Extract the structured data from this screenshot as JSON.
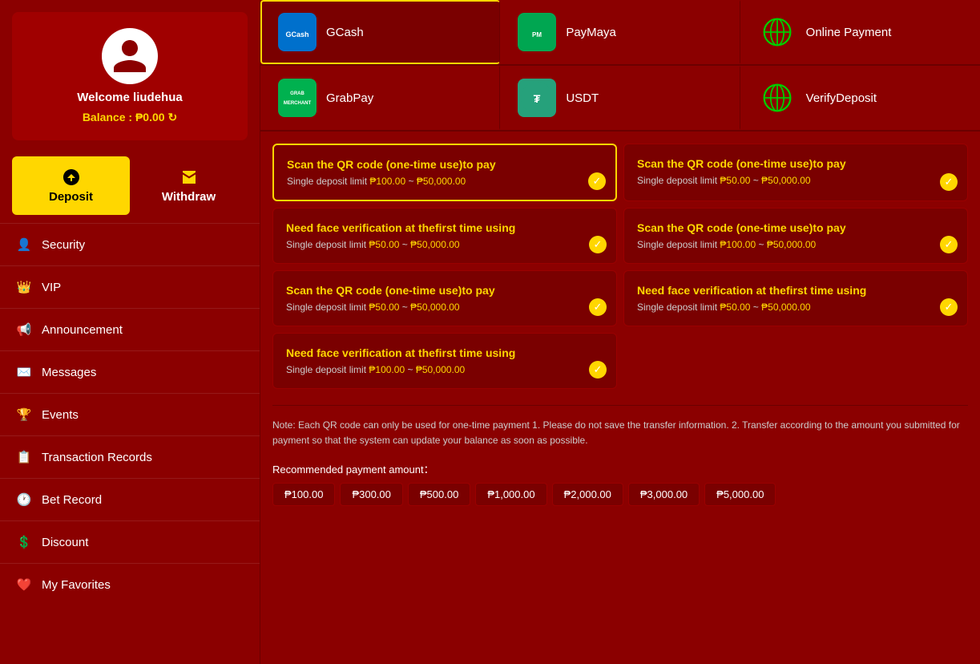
{
  "sidebar": {
    "welcome": "Welcome liudehua",
    "balance_label": "Balance :",
    "balance_value": "₱0.00",
    "deposit_label": "Deposit",
    "withdraw_label": "Withdraw",
    "menu_items": [
      {
        "icon": "security-icon",
        "label": "Security"
      },
      {
        "icon": "vip-icon",
        "label": "VIP"
      },
      {
        "icon": "announcement-icon",
        "label": "Announcement"
      },
      {
        "icon": "messages-icon",
        "label": "Messages"
      },
      {
        "icon": "events-icon",
        "label": "Events"
      },
      {
        "icon": "transaction-icon",
        "label": "Transaction Records"
      },
      {
        "icon": "bet-icon",
        "label": "Bet Record"
      },
      {
        "icon": "discount-icon",
        "label": "Discount"
      },
      {
        "icon": "favorites-icon",
        "label": "My Favorites"
      }
    ]
  },
  "payment_methods_row1": [
    {
      "id": "gcash",
      "name": "GCash",
      "selected": true
    },
    {
      "id": "paymaya",
      "name": "PayMaya",
      "selected": false
    },
    {
      "id": "online",
      "name": "Online Payment",
      "selected": false
    }
  ],
  "payment_methods_row2": [
    {
      "id": "grabpay",
      "name": "GrabPay",
      "selected": false
    },
    {
      "id": "usdt",
      "name": "USDT",
      "selected": false
    },
    {
      "id": "verify",
      "name": "VerifyDeposit",
      "selected": false
    }
  ],
  "deposit_options": [
    {
      "title": "Scan the QR code (one-time use)to pay",
      "limit_prefix": "Single deposit limit",
      "limit_min": "₱100.00",
      "limit_sep": "~",
      "limit_max": "₱50,000.00",
      "selected": true
    },
    {
      "title": "Scan the QR code (one-time use)to pay",
      "limit_prefix": "Single deposit limit",
      "limit_min": "₱50.00",
      "limit_sep": "~",
      "limit_max": "₱50,000.00",
      "selected": false
    },
    {
      "title": "Need face verification at thefirst time using",
      "limit_prefix": "Single deposit limit",
      "limit_min": "₱50.00",
      "limit_sep": "~",
      "limit_max": "₱50,000.00",
      "selected": false
    },
    {
      "title": "Scan the QR code (one-time use)to pay",
      "limit_prefix": "Single deposit limit",
      "limit_min": "₱100.00",
      "limit_sep": "~",
      "limit_max": "₱50,000.00",
      "selected": false
    },
    {
      "title": "Scan the QR code (one-time use)to pay",
      "limit_prefix": "Single deposit limit",
      "limit_min": "₱50.00",
      "limit_sep": "~",
      "limit_max": "₱50,000.00",
      "selected": false
    },
    {
      "title": "Need face verification at thefirst time using",
      "limit_prefix": "Single deposit limit",
      "limit_min": "₱50.00",
      "limit_sep": "~",
      "limit_max": "₱50,000.00",
      "selected": false
    },
    {
      "title": "Need face verification at thefirst time using",
      "limit_prefix": "Single deposit limit",
      "limit_min": "₱100.00",
      "limit_sep": "~",
      "limit_max": "₱50,000.00",
      "selected": false
    }
  ],
  "note": {
    "text": "Note: Each QR code can only be used for one-time payment 1. Please do not save the transfer information. 2. Transfer according to the amount you submitted for payment so that the system can update your balance as soon as possible.",
    "recommended_label": "Recommended payment amount："
  },
  "recommended_amounts": [
    "₱100.00",
    "₱300.00",
    "₱500.00",
    "₱1,000.00",
    "₱2,000.00",
    "₱3,000.00",
    "₱5,000.00"
  ]
}
